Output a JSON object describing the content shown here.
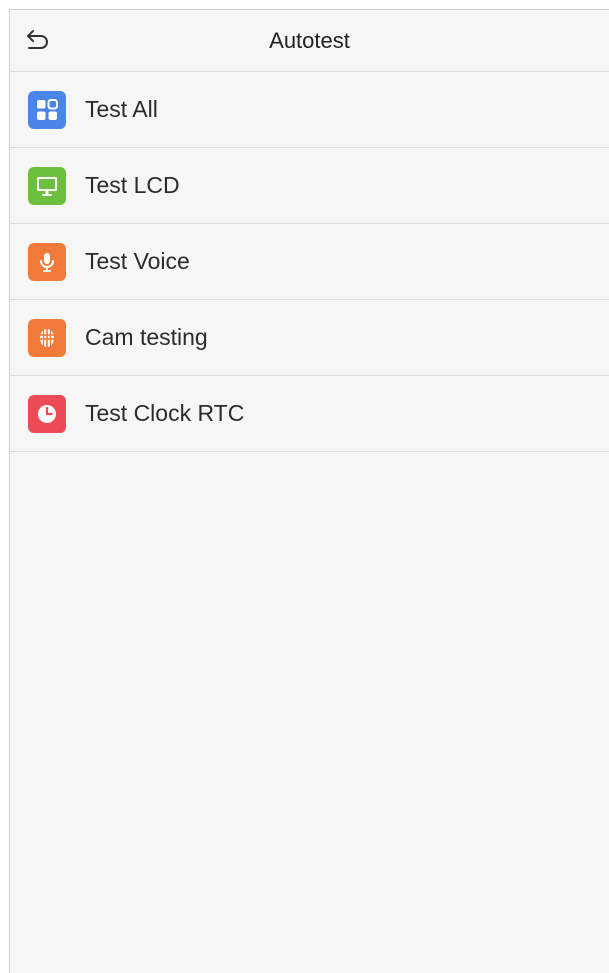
{
  "header": {
    "title": "Autotest",
    "back_icon": "back-arrow-icon"
  },
  "menu": {
    "items": [
      {
        "label": "Test All",
        "icon": "grid-icon",
        "color": "#4a86e8"
      },
      {
        "label": "Test LCD",
        "icon": "monitor-icon",
        "color": "#6dbf3e"
      },
      {
        "label": "Test Voice",
        "icon": "microphone-icon",
        "color": "#f07a3a"
      },
      {
        "label": "Cam testing",
        "icon": "face-scan-icon",
        "color": "#f07a3a"
      },
      {
        "label": "Test Clock RTC",
        "icon": "clock-icon",
        "color": "#ec4a55"
      }
    ]
  },
  "colors": {
    "background": "#f6f6f6",
    "divider": "#dcdcdc"
  }
}
